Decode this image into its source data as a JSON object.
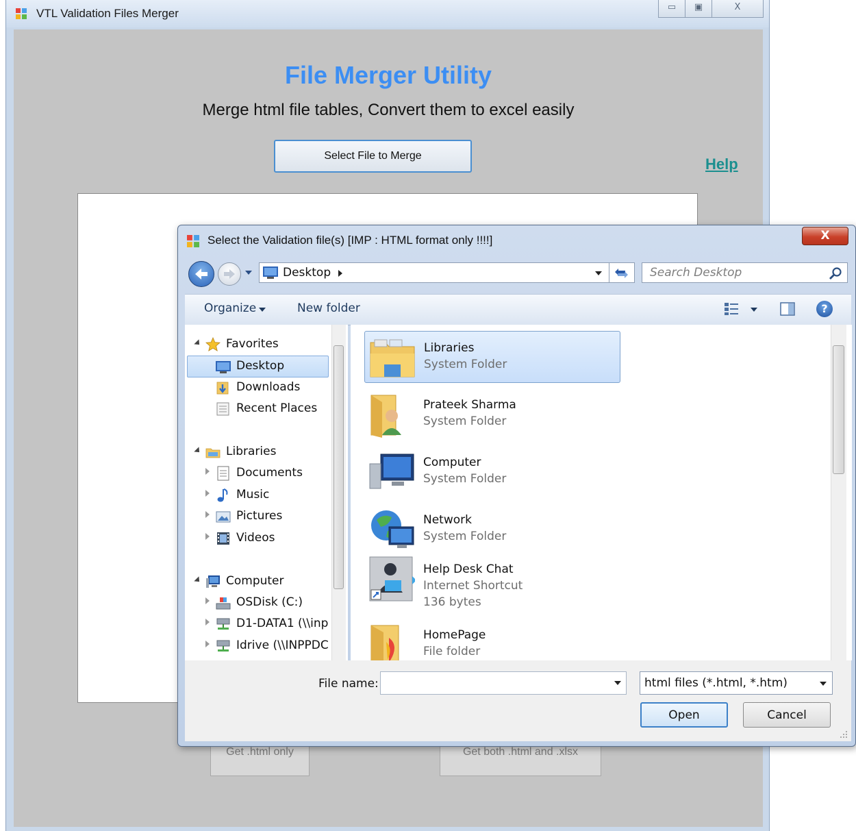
{
  "app": {
    "title": "VTL Validation Files Merger",
    "window_buttons": {
      "minimize": "▭",
      "maximize": "▣",
      "close": "X"
    },
    "heading": "File Merger Utility",
    "subtitle": "Merge html file tables, Convert them to excel easily",
    "select_button": "Select File to Merge",
    "help_link": "Help",
    "bottom_buttons": [
      "Get .html only",
      "Get both .html and .xlsx"
    ],
    "colors": {
      "heading": "#3c8ef3",
      "help": "#1b8f8f"
    }
  },
  "dialog": {
    "title": "Select the Validation file(s) [IMP :  HTML format only !!!!]",
    "close_label": "X",
    "address": {
      "location": "Desktop"
    },
    "search_placeholder": "Search Desktop",
    "toolbar": {
      "organize": "Organize",
      "new_folder": "New folder",
      "help": "?"
    },
    "nav": {
      "favorites": {
        "label": "Favorites",
        "items": [
          "Desktop",
          "Downloads",
          "Recent Places"
        ]
      },
      "libraries": {
        "label": "Libraries",
        "items": [
          "Documents",
          "Music",
          "Pictures",
          "Videos"
        ]
      },
      "computer": {
        "label": "Computer",
        "items": [
          "OSDisk (C:)",
          "D1-DATA1 (\\\\inp",
          "Idrive (\\\\INPPDC"
        ]
      },
      "selected": "Desktop"
    },
    "files": [
      {
        "name": "Libraries",
        "type": "System Folder",
        "icon": "libraries-folder-icon",
        "selected": true
      },
      {
        "name": "Prateek Sharma",
        "type": "System Folder",
        "icon": "user-folder-icon"
      },
      {
        "name": "Computer",
        "type": "System Folder",
        "icon": "computer-icon"
      },
      {
        "name": "Network",
        "type": "System Folder",
        "icon": "network-icon"
      },
      {
        "name": "Help Desk Chat",
        "type": "Internet Shortcut",
        "size": "136 bytes",
        "icon": "shortcut-icon"
      },
      {
        "name": "HomePage",
        "type": "File folder",
        "icon": "folder-icon"
      }
    ],
    "file_name_label": "File name:",
    "file_name_value": "",
    "filter": "html files (*.html, *.htm)",
    "open_button": "Open",
    "cancel_button": "Cancel"
  }
}
